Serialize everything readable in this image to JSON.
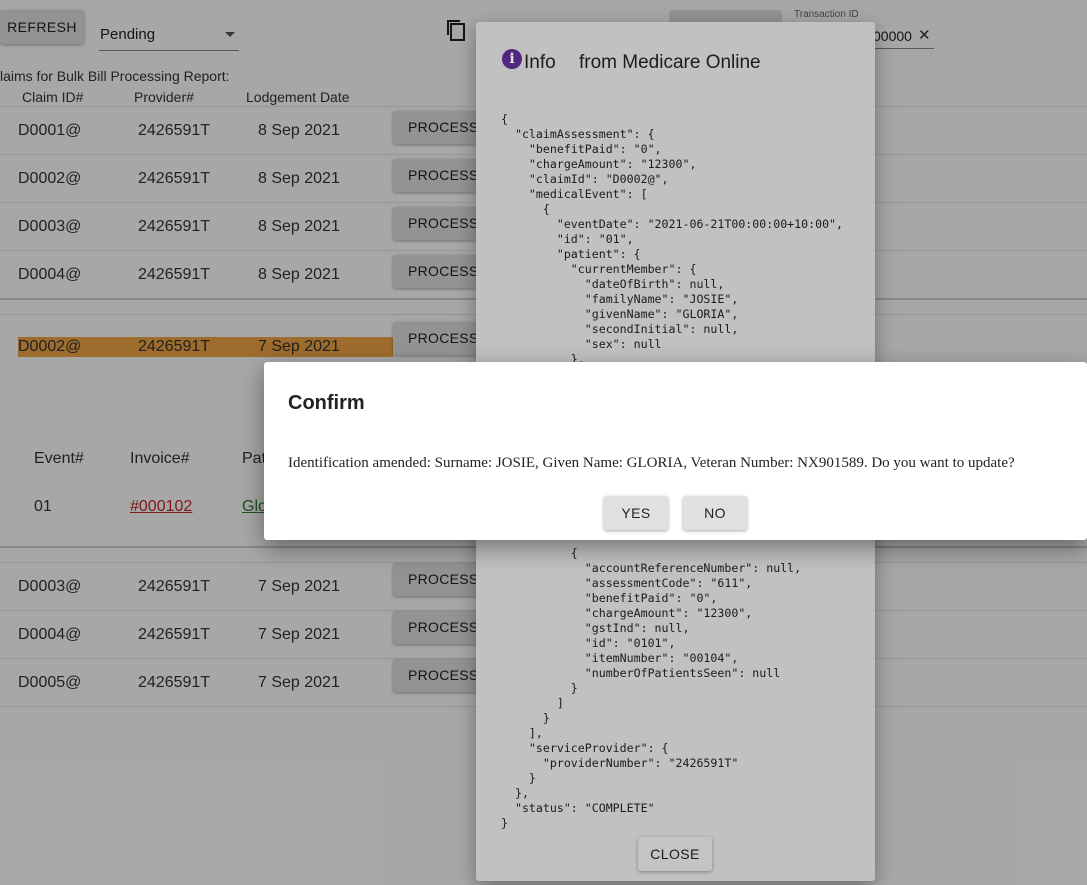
{
  "toolbar": {
    "refresh_label": "REFRESH",
    "status_select": "Pending",
    "transaction_id_label": "Transaction ID",
    "transaction_id_value": "00000"
  },
  "report": {
    "title": "laims for Bulk Bill Processing Report:",
    "columns": [
      "Claim ID#",
      "Provider#",
      "Lodgement Date"
    ],
    "rows1": [
      {
        "claim": "D0001@",
        "provider": "2426591T",
        "date": "8 Sep 2021",
        "action": "PROCESSING"
      },
      {
        "claim": "D0002@",
        "provider": "2426591T",
        "date": "8 Sep 2021",
        "action": "PROCESSING"
      },
      {
        "claim": "D0003@",
        "provider": "2426591T",
        "date": "8 Sep 2021",
        "action": "PROCESSING"
      },
      {
        "claim": "D0004@",
        "provider": "2426591T",
        "date": "8 Sep 2021",
        "action": "PROCESSING"
      }
    ],
    "highlight_row": {
      "claim": "D0002@",
      "provider": "2426591T",
      "date": "7 Sep 2021",
      "action": "PROCESSING"
    },
    "event_columns": [
      "Event#",
      "Invoice#",
      "Pat"
    ],
    "event_row": {
      "event": "01",
      "invoice": "#000102",
      "patient": "Glo"
    },
    "rows2": [
      {
        "claim": "D0003@",
        "provider": "2426591T",
        "date": "7 Sep 2021",
        "action": "PROCESSING"
      },
      {
        "claim": "D0004@",
        "provider": "2426591T",
        "date": "7 Sep 2021",
        "action": "PROCESSING"
      },
      {
        "claim": "D0005@",
        "provider": "2426591T",
        "date": "7 Sep 2021",
        "action": "PROCESSING"
      }
    ]
  },
  "info_dialog": {
    "title_info": "Info",
    "title_source": "from Medicare Online",
    "json_top": "{\n  \"claimAssessment\": {\n    \"benefitPaid\": \"0\",\n    \"chargeAmount\": \"12300\",\n    \"claimId\": \"D0002@\",\n    \"medicalEvent\": [\n      {\n        \"eventDate\": \"2021-06-21T00:00:00+10:00\",\n        \"id\": \"01\",\n        \"patient\": {\n          \"currentMember\": {\n            \"dateOfBirth\": null,\n            \"familyName\": \"JOSIE\",\n            \"givenName\": \"GLORIA\",\n            \"secondInitial\": null,\n            \"sex\": null\n          },",
    "json_bottom": "          {\n            \"accountReferenceNumber\": null,\n            \"assessmentCode\": \"611\",\n            \"benefitPaid\": \"0\",\n            \"chargeAmount\": \"12300\",\n            \"gstInd\": null,\n            \"id\": \"0101\",\n            \"itemNumber\": \"00104\",\n            \"numberOfPatientsSeen\": null\n          }\n        ]\n      }\n    ],\n    \"serviceProvider\": {\n      \"providerNumber\": \"2426591T\"\n    }\n  },\n  \"status\": \"COMPLETE\"\n}",
    "close_label": "CLOSE"
  },
  "confirm_dialog": {
    "title": "Confirm",
    "message": "Identification amended: Surname: JOSIE, Given Name: GLORIA, Veteran Number: NX901589. Do you want to update?",
    "yes_label": "YES",
    "no_label": "NO"
  },
  "colors": {
    "highlight": "#f0a646",
    "invoice_link": "#c62828",
    "patient_link": "#2e7d32",
    "info_icon": "#5b2d91"
  }
}
